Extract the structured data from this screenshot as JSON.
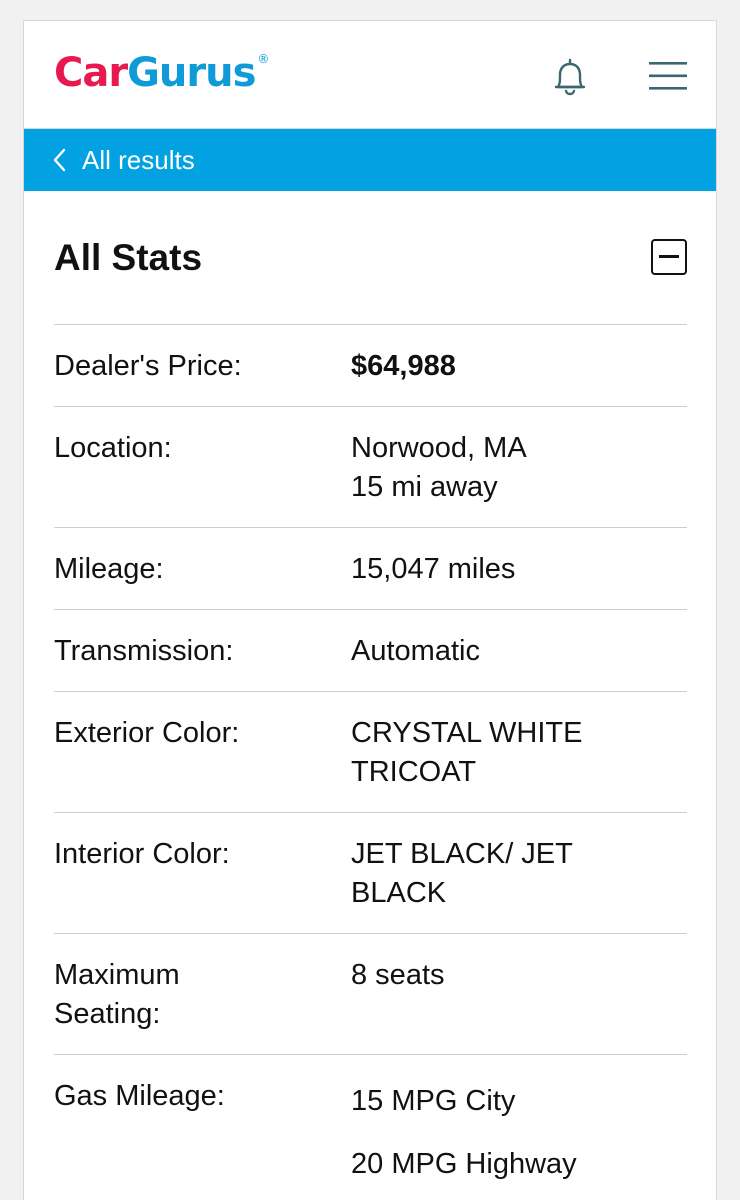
{
  "header": {
    "logo": {
      "part1": "Car",
      "part2": "Gurus",
      "reg": "®"
    },
    "icons": [
      "bell-icon",
      "hamburger-menu-icon"
    ]
  },
  "back": {
    "label": "All results"
  },
  "stats": {
    "title": "All Stats",
    "rows": [
      {
        "label": "Dealer's Price:",
        "value_lines": [
          "$64,988"
        ]
      },
      {
        "label": "Location:",
        "value_lines": [
          "Norwood, MA",
          "15 mi away"
        ]
      },
      {
        "label": "Mileage:",
        "value_lines": [
          "15,047 miles"
        ]
      },
      {
        "label": "Transmission:",
        "value_lines": [
          "Automatic"
        ]
      },
      {
        "label": "Exterior Color:",
        "value_lines": [
          "CRYSTAL WHITE",
          "TRICOAT"
        ]
      },
      {
        "label": "Interior Color:",
        "value_lines": [
          "JET BLACK/ JET",
          "BLACK"
        ]
      },
      {
        "label_lines": [
          "Maximum",
          "Seating:"
        ],
        "value_lines": [
          "8 seats"
        ]
      },
      {
        "label": "Gas Mileage:",
        "value_lines": [
          "15 MPG City",
          "20 MPG Highway"
        ]
      }
    ]
  },
  "colors": {
    "brand_red": "#e8194e",
    "brand_blue": "#0e9bd8",
    "bar_blue": "#02a1e1"
  }
}
